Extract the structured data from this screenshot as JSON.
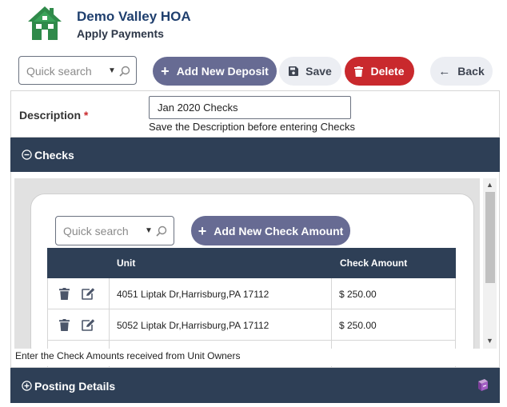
{
  "header": {
    "title": "Demo Valley HOA",
    "subtitle": "Apply Payments",
    "logo_icon": "house-icon",
    "logo_color": "#2f8a4a"
  },
  "toolbar": {
    "search_placeholder": "Quick search",
    "add_deposit_label": "Add New Deposit",
    "save_label": "Save",
    "delete_label": "Delete",
    "back_label": "Back"
  },
  "description": {
    "label": "Description",
    "required_mark": "*",
    "value": "Jan 2020 Checks",
    "hint": "Save the Description before entering Checks"
  },
  "checks": {
    "section_title": "Checks",
    "search_placeholder": "Quick search",
    "add_check_label": "Add New Check Amount",
    "columns": [
      "Unit",
      "Check Amount"
    ],
    "rows": [
      {
        "unit": "4051 Liptak Dr,Harrisburg,PA 17112",
        "amount": "$ 250.00"
      },
      {
        "unit": "5052 Liptak Dr,Harrisburg,PA 17112",
        "amount": "$ 250.00"
      }
    ],
    "footer_note": "Enter the Check Amounts received from Unit Owners"
  },
  "posting": {
    "section_title": "Posting Details"
  },
  "colors": {
    "accent": "#676b93",
    "danger": "#c9292d",
    "header_bar": "#2e3f56",
    "title": "#1f3f6e"
  }
}
